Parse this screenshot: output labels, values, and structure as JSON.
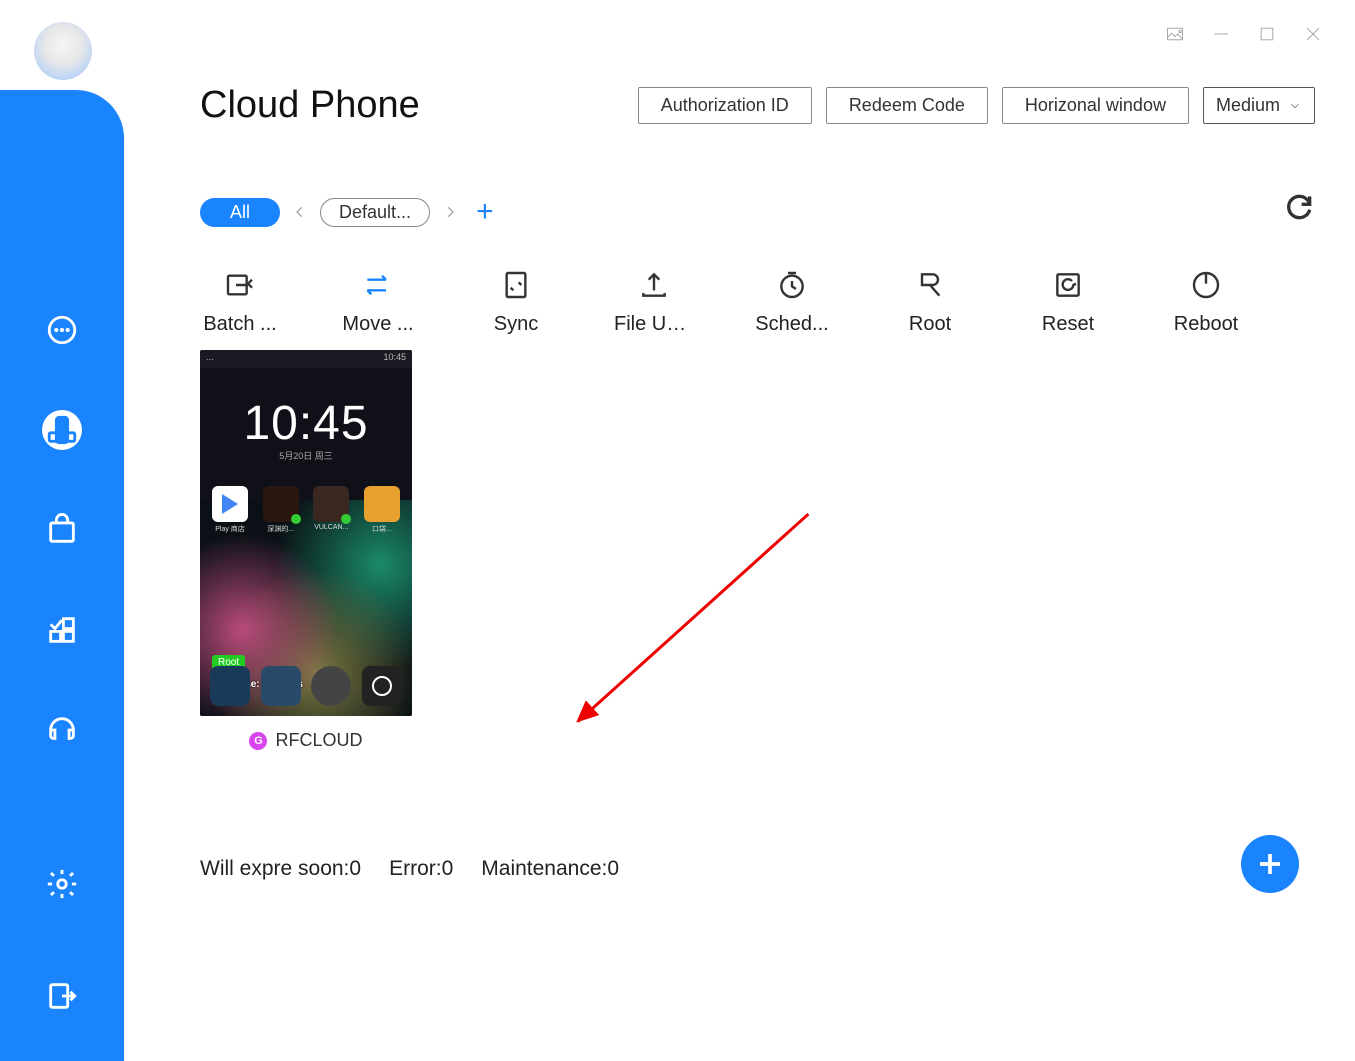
{
  "page_title": "Cloud Phone",
  "window_controls": {
    "screenshot": "screenshot-icon",
    "min": "minimize-icon",
    "max": "maximize-icon",
    "close": "close-icon"
  },
  "header_buttons": {
    "authorization": "Authorization ID",
    "redeem": "Redeem Code",
    "horizontal": "Horizonal window",
    "size_select": "Medium"
  },
  "tag_row": {
    "all": "All",
    "default": "Default..."
  },
  "toolbar": {
    "batch": "Batch ...",
    "move": "Move ...",
    "sync": "Sync",
    "file_upload": "File Up...",
    "schedule": "Sched...",
    "root": "Root",
    "reset": "Reset",
    "reboot": "Reboot"
  },
  "phone": {
    "status_left": "...",
    "status_right": "10:45",
    "clock": "10:45",
    "date": "5月20日  周三",
    "apps": [
      "Play 商店",
      "深渊的...",
      "VULCAN...",
      "口袋..."
    ],
    "root_chip": "Root",
    "left_time": "Left Time: 227Days",
    "label_g": "G",
    "label": "RFCLOUD"
  },
  "status": {
    "expire": "Will expre soon:0",
    "error": "Error:0",
    "maintenance": "Maintenance:0"
  }
}
